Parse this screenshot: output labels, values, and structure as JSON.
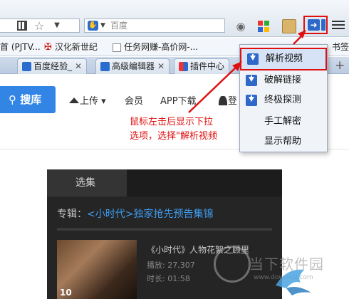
{
  "toolbar": {
    "search_engine_placeholder": "百度"
  },
  "bookmarks": [
    {
      "label": "首 (PJTV..."
    },
    {
      "label": "汉化新世纪"
    },
    {
      "label": "任务网赚-高价网-..."
    }
  ],
  "bookmarks_tail": "书签",
  "tabs": [
    {
      "label": "百度经验_"
    },
    {
      "label": "高级编辑器"
    },
    {
      "label": "插件中心"
    }
  ],
  "page": {
    "search_button": "搜库",
    "nav": {
      "upload": "上传",
      "member": "会员",
      "app": "APP下载",
      "login": "登"
    },
    "player": {
      "tab_episodes": "选集",
      "album_prefix": "专辑：",
      "album_link": "<小时代>独家抢先预告集锦",
      "episode_number": "10",
      "episode_title": "《小时代》人物花絮之顾里",
      "plays": "播放: 27,307",
      "duration": "时长: 01:58"
    },
    "watermark": {
      "text": "当下软件园",
      "url": "www.downxia.com"
    }
  },
  "dropdown": {
    "items": [
      {
        "label": "解析视频"
      },
      {
        "label": "破解链接"
      },
      {
        "label": "终极探测"
      },
      {
        "label": "手工解密"
      },
      {
        "label": "显示帮助"
      }
    ]
  },
  "annotation": {
    "line1": "鼠标左击后显示下拉",
    "line2": "选项，选择\"解析视频"
  },
  "colors": {
    "highlight": "#e01010",
    "accent": "#3385e5",
    "link": "#3d9cf0"
  }
}
